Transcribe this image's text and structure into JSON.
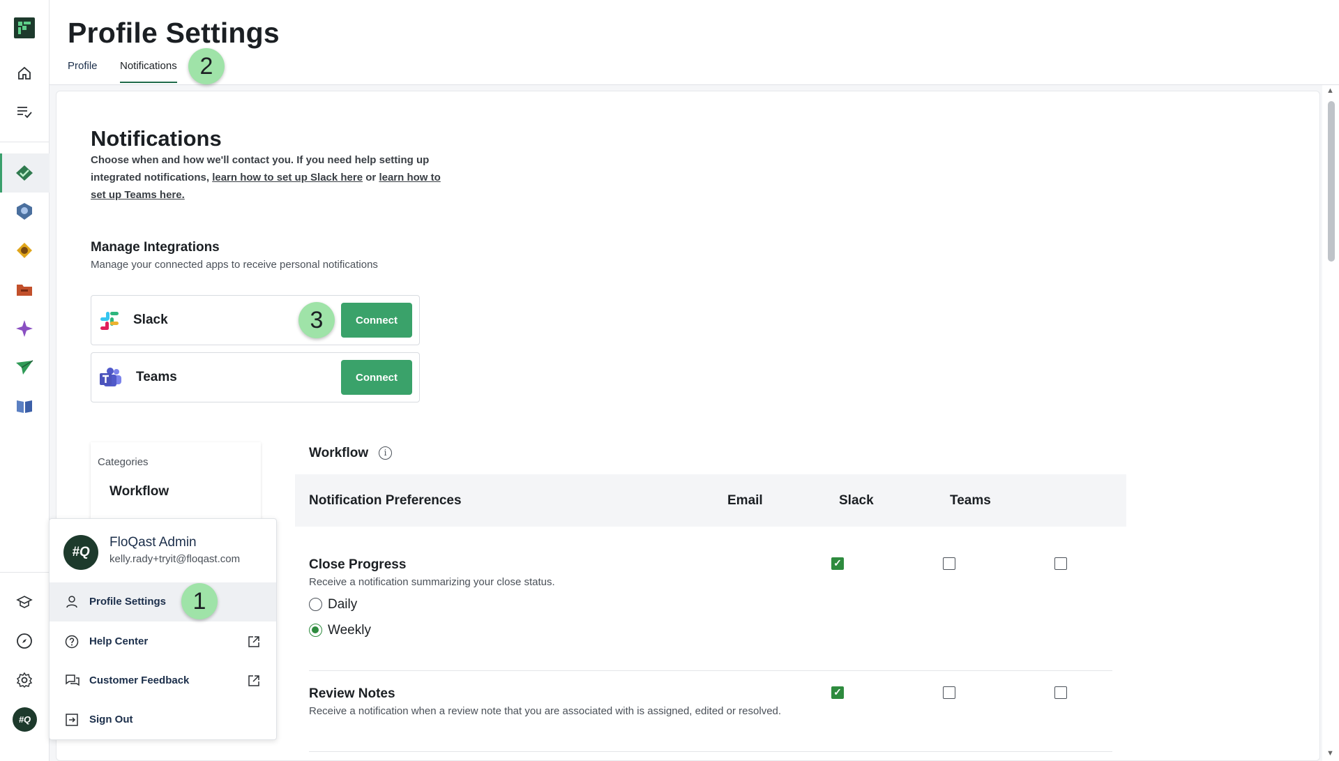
{
  "app": {
    "page_title": "Profile Settings"
  },
  "tabs": [
    {
      "label": "Profile"
    },
    {
      "label": "Notifications"
    }
  ],
  "badges": {
    "one": "1",
    "two": "2",
    "three": "3"
  },
  "notifications": {
    "title": "Notifications",
    "desc_text": "Choose when and how we'll contact you. If you need help setting up integrated notifications,",
    "slack_link": "learn how to set up Slack here",
    "or_text": "or",
    "teams_link": "learn how to set up Teams here."
  },
  "integrations": {
    "title": "Manage Integrations",
    "subtitle": "Manage your connected apps to receive personal notifications",
    "items": [
      {
        "name": "Slack",
        "button": "Connect"
      },
      {
        "name": "Teams",
        "button": "Connect"
      }
    ]
  },
  "categories": {
    "label": "Categories",
    "items": [
      "Workflow"
    ]
  },
  "workflow": {
    "title": "Workflow",
    "info_icon": "i",
    "header": {
      "col_pref": "Notification Preferences",
      "col_email": "Email",
      "col_slack": "Slack",
      "col_teams": "Teams"
    },
    "prefs": [
      {
        "title": "Close Progress",
        "description": "Receive a notification summarizing your close status.",
        "email": true,
        "slack": false,
        "teams": false,
        "frequency_options": [
          "Daily",
          "Weekly"
        ],
        "frequency_selected": "Weekly"
      },
      {
        "title": "Review Notes",
        "description": "Receive a notification when a review note that you are associated with is assigned, edited or resolved.",
        "email": true,
        "slack": false,
        "teams": false
      }
    ]
  },
  "user_menu": {
    "avatar_text": "#Q",
    "name": "FloQast Admin",
    "email": "kelly.rady+tryit@floqast.com",
    "items": [
      {
        "label": "Profile Settings",
        "icon": "person-icon"
      },
      {
        "label": "Help Center",
        "icon": "help-icon"
      },
      {
        "label": "Customer Feedback",
        "icon": "feedback-icon"
      },
      {
        "label": "Sign Out",
        "icon": "sign-out-icon"
      }
    ]
  },
  "colors": {
    "accent": "#3aa26a",
    "check": "#2e8b3e",
    "badge": "#9fe3a8"
  }
}
